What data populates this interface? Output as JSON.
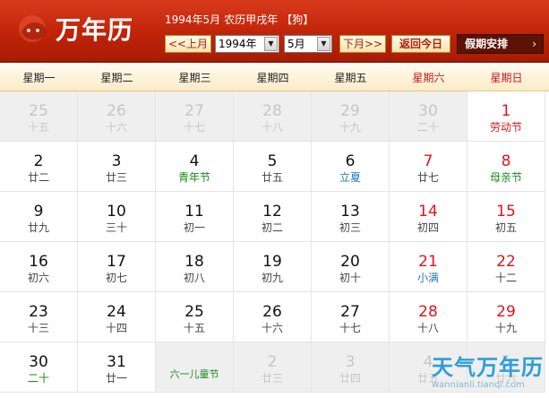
{
  "header": {
    "logo_text": "万年历",
    "info": {
      "date": "1994年5月",
      "lunar": "农历甲戌年",
      "zodiac": "【狗】"
    },
    "prev_label": "<<上月",
    "year_value": "1994年",
    "month_value": "5月",
    "next_label": "下月>>",
    "today_label": "返回今日",
    "holiday_label": "假期安排",
    "holiday_chevron": "›"
  },
  "weekdays": [
    "星期一",
    "星期二",
    "星期三",
    "星期四",
    "星期五",
    "星期六",
    "星期日"
  ],
  "days": [
    {
      "n": "25",
      "l": "十五",
      "other": true
    },
    {
      "n": "26",
      "l": "十六",
      "other": true
    },
    {
      "n": "27",
      "l": "十七",
      "other": true
    },
    {
      "n": "28",
      "l": "十八",
      "other": true
    },
    {
      "n": "29",
      "l": "十九",
      "other": true
    },
    {
      "n": "30",
      "l": "二十",
      "other": true
    },
    {
      "n": "1",
      "l": "劳动节",
      "weekend": true,
      "lc": "red"
    },
    {
      "n": "2",
      "l": "廿二"
    },
    {
      "n": "3",
      "l": "廿三"
    },
    {
      "n": "4",
      "l": "青年节",
      "lc": "green"
    },
    {
      "n": "5",
      "l": "廿五"
    },
    {
      "n": "6",
      "l": "立夏",
      "lc": "blue"
    },
    {
      "n": "7",
      "l": "廿七",
      "weekend": true
    },
    {
      "n": "8",
      "l": "母亲节",
      "weekend": true,
      "lc": "green"
    },
    {
      "n": "9",
      "l": "廿九"
    },
    {
      "n": "10",
      "l": "三十"
    },
    {
      "n": "11",
      "l": "初一"
    },
    {
      "n": "12",
      "l": "初二"
    },
    {
      "n": "13",
      "l": "初三"
    },
    {
      "n": "14",
      "l": "初四",
      "weekend": true
    },
    {
      "n": "15",
      "l": "初五",
      "weekend": true
    },
    {
      "n": "16",
      "l": "初六"
    },
    {
      "n": "17",
      "l": "初七"
    },
    {
      "n": "18",
      "l": "初八"
    },
    {
      "n": "19",
      "l": "初九"
    },
    {
      "n": "20",
      "l": "初十"
    },
    {
      "n": "21",
      "l": "小满",
      "weekend": true,
      "lc": "blue"
    },
    {
      "n": "22",
      "l": "十二",
      "weekend": true
    },
    {
      "n": "23",
      "l": "十三"
    },
    {
      "n": "24",
      "l": "十四"
    },
    {
      "n": "25",
      "l": "十五"
    },
    {
      "n": "26",
      "l": "十六"
    },
    {
      "n": "27",
      "l": "十七"
    },
    {
      "n": "28",
      "l": "十八",
      "weekend": true
    },
    {
      "n": "29",
      "l": "十九",
      "weekend": true
    },
    {
      "n": "30",
      "l": "二十",
      "lc": "green"
    },
    {
      "n": "31",
      "l": "廿一"
    },
    {
      "n": "",
      "l": "六一儿童节",
      "other": true,
      "lc": "green",
      "bottom": true
    },
    {
      "n": "2",
      "l": "廿三",
      "other": true
    },
    {
      "n": "3",
      "l": "廿四",
      "other": true
    },
    {
      "n": "4",
      "l": "廿五",
      "other": true
    },
    {
      "n": "5",
      "l": "廿六",
      "other": true
    }
  ],
  "watermark": {
    "title": "天气万年历",
    "url": "wannianli.tianqi.com"
  },
  "colors": {
    "header_red": "#c02408",
    "weekend_red": "#e0141c",
    "festival_green": "#1a8a1a",
    "term_blue": "#2478c2"
  }
}
